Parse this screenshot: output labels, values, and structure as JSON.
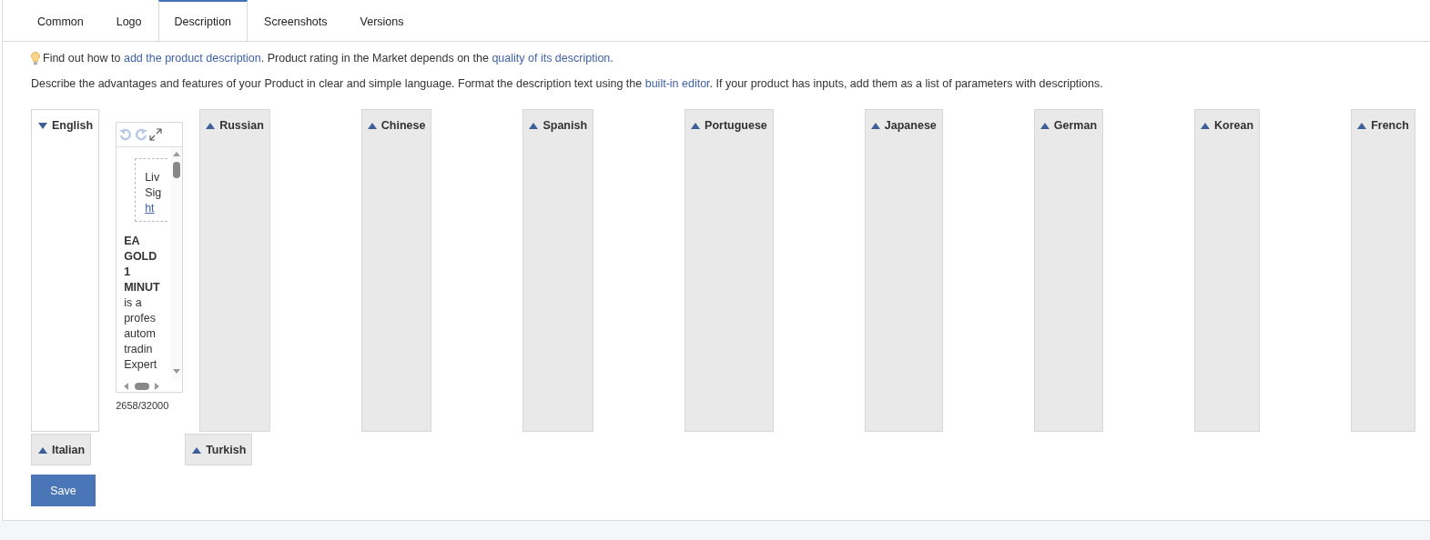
{
  "tabs": [
    {
      "label": "Common",
      "selected": false
    },
    {
      "label": "Logo",
      "selected": false
    },
    {
      "label": "Description",
      "selected": true
    },
    {
      "label": "Screenshots",
      "selected": false
    },
    {
      "label": "Versions",
      "selected": false
    }
  ],
  "hint": [
    {
      "kind": "text",
      "text": "Find out how to "
    },
    {
      "kind": "link",
      "text": "add the product description"
    },
    {
      "kind": "text",
      "text": ". Product rating in the Market depends on the "
    },
    {
      "kind": "link",
      "text": "quality of its description"
    },
    {
      "kind": "text",
      "text": "."
    }
  ],
  "instructions": [
    {
      "kind": "text",
      "text": "Describe the advantages and features of your Product in clear and simple language. Format the description text using the "
    },
    {
      "kind": "link",
      "text": "built-in editor"
    },
    {
      "kind": "text",
      "text": ". If your product has inputs, add them as a list of parameters with descriptions."
    }
  ],
  "languages_row1": [
    {
      "name": "English",
      "expanded": true
    },
    {
      "name": "Russian",
      "expanded": false
    },
    {
      "name": "Chinese",
      "expanded": false
    },
    {
      "name": "Spanish",
      "expanded": false
    },
    {
      "name": "Portuguese",
      "expanded": false
    },
    {
      "name": "Japanese",
      "expanded": false
    },
    {
      "name": "German",
      "expanded": false
    },
    {
      "name": "Korean",
      "expanded": false
    },
    {
      "name": "French",
      "expanded": false
    }
  ],
  "languages_row2": [
    {
      "name": "Italian",
      "expanded": false
    },
    {
      "name": "Turkish",
      "expanded": false
    }
  ],
  "editor": {
    "box_lines": [
      {
        "kind": "text",
        "text": "Liv"
      },
      {
        "kind": "text",
        "text": "Sig"
      },
      {
        "kind": "link",
        "text": "ht"
      }
    ],
    "body_lines": [
      {
        "kind": "bold",
        "text": "EA"
      },
      {
        "kind": "bold",
        "text": "GOLD"
      },
      {
        "kind": "bold",
        "text": "1"
      },
      {
        "kind": "bold",
        "text": "MINUT"
      },
      {
        "kind": "text",
        "text": "is a"
      },
      {
        "kind": "text",
        "text": "profes"
      },
      {
        "kind": "text",
        "text": "autom"
      },
      {
        "kind": "text",
        "text": "tradin"
      },
      {
        "kind": "text",
        "text": "Expert"
      }
    ],
    "counter": "2658/32000"
  },
  "save_button": "Save"
}
